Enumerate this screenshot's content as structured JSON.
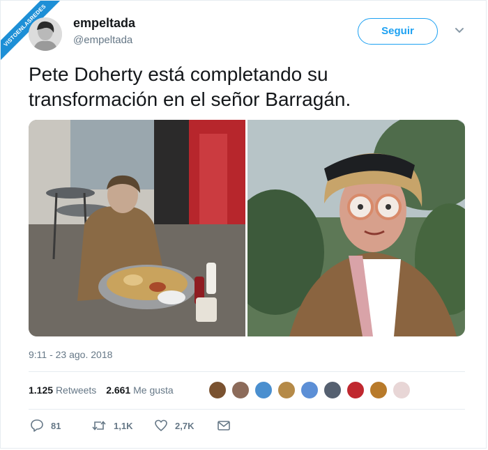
{
  "watermark": "VISTOENLASREDES",
  "author": {
    "name": "empeltada",
    "handle": "@empeltada"
  },
  "follow_label": "Seguir",
  "tweet_text": "Pete Doherty está completando su transformación en el señor Barragán.",
  "timestamp": "9:11 - 23 ago. 2018",
  "stats": {
    "retweets_count": "1.125",
    "retweets_label": "Retweets",
    "likes_count": "2.661",
    "likes_label": "Me gusta"
  },
  "likers": [
    {
      "color": "#7a5230"
    },
    {
      "color": "#8c6b5a"
    },
    {
      "color": "#4a8fcf"
    },
    {
      "color": "#b58a48"
    },
    {
      "color": "#5c8fd6"
    },
    {
      "color": "#556070"
    },
    {
      "color": "#c0282f"
    },
    {
      "color": "#b87a2a"
    },
    {
      "color": "#e8d6d6"
    }
  ],
  "actions": {
    "replies": "81",
    "retweets": "1,1K",
    "likes": "2,7K"
  },
  "colors": {
    "accent": "#1da1f2",
    "text": "#14171a",
    "muted": "#657786",
    "watermark": "#1d8fd6"
  }
}
